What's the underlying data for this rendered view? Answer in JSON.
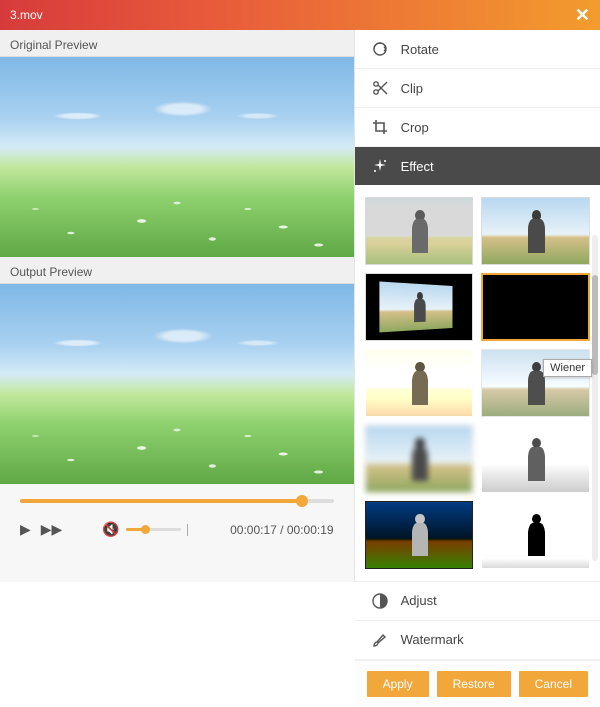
{
  "titlebar": {
    "filename": "3.mov"
  },
  "left": {
    "original_label": "Original Preview",
    "output_label": "Output Preview",
    "time_current": "00:00:17",
    "time_total": "00:00:19",
    "time_sep": " / "
  },
  "tools": {
    "rotate": "Rotate",
    "clip": "Clip",
    "crop": "Crop",
    "effect": "Effect",
    "adjust": "Adjust",
    "watermark": "Watermark"
  },
  "effects": {
    "tooltip": "Wiener",
    "selected_index": 3
  },
  "footer": {
    "apply": "Apply",
    "restore": "Restore",
    "cancel": "Cancel"
  },
  "colors": {
    "accent": "#f2a73b"
  }
}
